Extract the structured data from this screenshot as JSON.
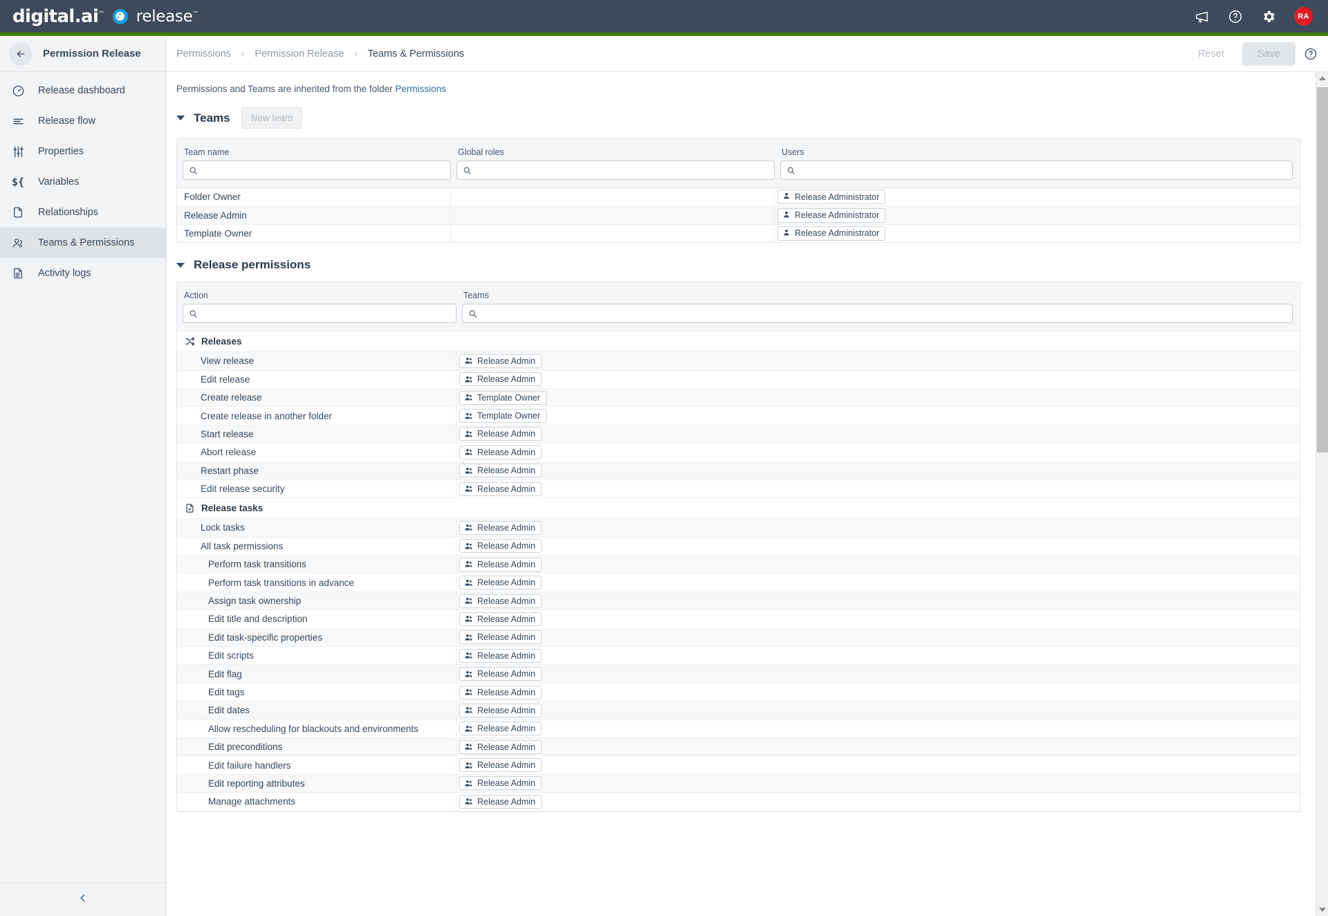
{
  "topbar": {
    "brand_primary": "digital.ai",
    "brand_secondary": "release",
    "icons": [
      "megaphone-icon",
      "help-circle-icon",
      "gear-icon"
    ],
    "avatar_initials": "RA",
    "background": "#3c4a5b",
    "accent": "#3d7d07",
    "avatar_color": "#e01b24"
  },
  "sidebar": {
    "title": "Permission Release",
    "back_icon": "arrow-left-icon",
    "collapse_icon": "chevron-left-icon",
    "items": [
      {
        "label": "Release dashboard",
        "icon": "gauge-icon",
        "active": false
      },
      {
        "label": "Release flow",
        "icon": "flow-lines-icon",
        "active": false
      },
      {
        "label": "Properties",
        "icon": "sliders-icon",
        "active": false
      },
      {
        "label": "Variables",
        "icon": "variable-icon",
        "active": false
      },
      {
        "label": "Relationships",
        "icon": "document-icon",
        "active": false
      },
      {
        "label": "Teams & Permissions",
        "icon": "people-icon",
        "active": true
      },
      {
        "label": "Activity logs",
        "icon": "document-lines-icon",
        "active": false
      }
    ]
  },
  "breadcrumb": {
    "items": [
      "Permissions",
      "Permission Release",
      "Teams & Permissions"
    ],
    "separator": "›"
  },
  "actions": {
    "reset_label": "Reset",
    "save_label": "Save",
    "help_icon": "help-circle-icon"
  },
  "main": {
    "inherit_note_prefix": "Permissions and Teams are inherited from the folder ",
    "inherit_note_link": "Permissions"
  },
  "teams_section": {
    "title": "Teams",
    "new_team_label": "New team",
    "columns": [
      "Team name",
      "Global roles",
      "Users"
    ],
    "filter_placeholder": "",
    "rows": [
      {
        "team_name": "Folder Owner",
        "global_roles": [],
        "users": [
          "Release Administrator"
        ]
      },
      {
        "team_name": "Release Admin",
        "global_roles": [],
        "users": [
          "Release Administrator"
        ]
      },
      {
        "team_name": "Template Owner",
        "global_roles": [],
        "users": [
          "Release Administrator"
        ]
      }
    ]
  },
  "permissions_section": {
    "title": "Release permissions",
    "columns": [
      "Action",
      "Teams"
    ],
    "filter_placeholder": "",
    "groups": [
      {
        "label": "Releases",
        "icon": "shuffle-icon",
        "rows": [
          {
            "action": "View release",
            "indent": 0,
            "teams": [
              "Release Admin"
            ]
          },
          {
            "action": "Edit release",
            "indent": 0,
            "teams": [
              "Release Admin"
            ]
          },
          {
            "action": "Create release",
            "indent": 0,
            "teams": [
              "Template Owner"
            ]
          },
          {
            "action": "Create release in another folder",
            "indent": 0,
            "teams": [
              "Template Owner"
            ]
          },
          {
            "action": "Start release",
            "indent": 0,
            "teams": [
              "Release Admin"
            ]
          },
          {
            "action": "Abort release",
            "indent": 0,
            "teams": [
              "Release Admin"
            ]
          },
          {
            "action": "Restart phase",
            "indent": 0,
            "teams": [
              "Release Admin"
            ]
          },
          {
            "action": "Edit release security",
            "indent": 0,
            "teams": [
              "Release Admin"
            ]
          }
        ]
      },
      {
        "label": "Release tasks",
        "icon": "document-check-icon",
        "rows": [
          {
            "action": "Lock tasks",
            "indent": 0,
            "teams": [
              "Release Admin"
            ]
          },
          {
            "action": "All task permissions",
            "indent": 0,
            "teams": [
              "Release Admin"
            ]
          },
          {
            "action": "Perform task transitions",
            "indent": 1,
            "teams": [
              "Release Admin"
            ]
          },
          {
            "action": "Perform task transitions in advance",
            "indent": 1,
            "teams": [
              "Release Admin"
            ]
          },
          {
            "action": "Assign task ownership",
            "indent": 1,
            "teams": [
              "Release Admin"
            ]
          },
          {
            "action": "Edit title and description",
            "indent": 1,
            "teams": [
              "Release Admin"
            ]
          },
          {
            "action": "Edit task-specific properties",
            "indent": 1,
            "teams": [
              "Release Admin"
            ]
          },
          {
            "action": "Edit scripts",
            "indent": 1,
            "teams": [
              "Release Admin"
            ]
          },
          {
            "action": "Edit flag",
            "indent": 1,
            "teams": [
              "Release Admin"
            ]
          },
          {
            "action": "Edit tags",
            "indent": 1,
            "teams": [
              "Release Admin"
            ]
          },
          {
            "action": "Edit dates",
            "indent": 1,
            "teams": [
              "Release Admin"
            ]
          },
          {
            "action": "Allow rescheduling for blackouts and environments",
            "indent": 1,
            "teams": [
              "Release Admin"
            ]
          },
          {
            "action": "Edit preconditions",
            "indent": 1,
            "teams": [
              "Release Admin"
            ]
          },
          {
            "action": "Edit failure handlers",
            "indent": 1,
            "teams": [
              "Release Admin"
            ]
          },
          {
            "action": "Edit reporting attributes",
            "indent": 1,
            "teams": [
              "Release Admin"
            ]
          },
          {
            "action": "Manage attachments",
            "indent": 1,
            "teams": [
              "Release Admin"
            ]
          }
        ]
      }
    ]
  },
  "scrollbar": {
    "up_icon": "triangle-up-icon",
    "down_icon": "triangle-down-icon"
  }
}
